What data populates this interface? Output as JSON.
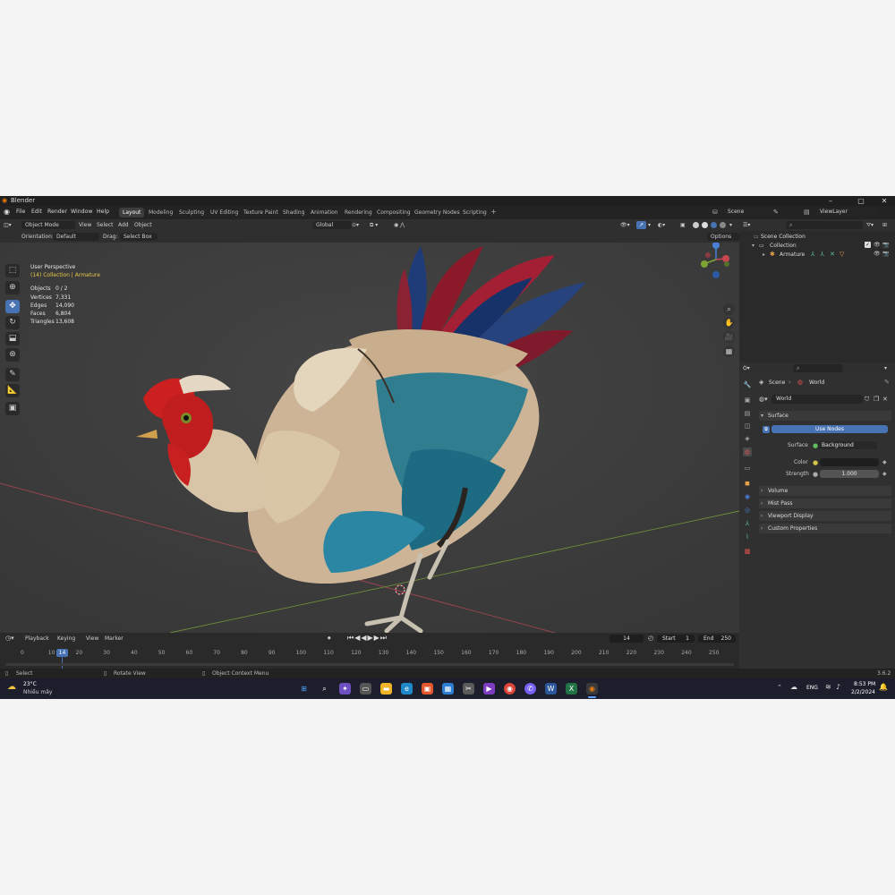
{
  "window": {
    "title": "Blender"
  },
  "menu": [
    "File",
    "Edit",
    "Render",
    "Window",
    "Help"
  ],
  "workspaces": [
    "Layout",
    "Modeling",
    "Sculpting",
    "UV Editing",
    "Texture Paint",
    "Shading",
    "Animation",
    "Rendering",
    "Compositing",
    "Geometry Nodes",
    "Scripting"
  ],
  "scene_field": "Scene",
  "viewlayer_field": "ViewLayer",
  "viewport_header": {
    "mode": "Object Mode",
    "items": [
      "View",
      "Select",
      "Add",
      "Object"
    ],
    "transform": "Global",
    "options": "Options"
  },
  "tool_header": {
    "orientation_label": "Orientation:",
    "orientation_value": "Default",
    "drag_label": "Drag:",
    "drag_value": "Select Box"
  },
  "overlay": {
    "view_name": "User Perspective",
    "collection_path": "(14) Collection | Armature"
  },
  "stats": [
    {
      "label": "Objects",
      "value": "0 / 2"
    },
    {
      "label": "Vertices",
      "value": "7,331"
    },
    {
      "label": "Edges",
      "value": "14,090"
    },
    {
      "label": "Faces",
      "value": "6,804"
    },
    {
      "label": "Triangles",
      "value": "13,608"
    }
  ],
  "timeline": {
    "menus": [
      "Playback",
      "Keying",
      "View",
      "Marker"
    ],
    "current_frame": "14",
    "start_label": "Start",
    "start": "1",
    "end_label": "End",
    "end": "250",
    "ticks": [
      "0",
      "10",
      "20",
      "30",
      "40",
      "50",
      "60",
      "70",
      "80",
      "90",
      "100",
      "110",
      "120",
      "130",
      "140",
      "150",
      "160",
      "170",
      "180",
      "190",
      "200",
      "210",
      "220",
      "230",
      "240",
      "250"
    ]
  },
  "statusbar": {
    "select": "Select",
    "rotate": "Rotate View",
    "context": "Object Context Menu",
    "version": "3.6.2"
  },
  "outliner": {
    "rows": [
      {
        "label": "Scene Collection"
      },
      {
        "label": "Collection"
      },
      {
        "label": "Armature"
      }
    ]
  },
  "properties": {
    "breadcrumb_scene": "Scene",
    "breadcrumb_world": "World",
    "world_name": "World",
    "surface_panel": "Surface",
    "use_nodes": "Use Nodes",
    "surface_label": "Surface",
    "surface_value": "Background",
    "color_label": "Color",
    "strength_label": "Strength",
    "strength_value": "1.000",
    "collapsed_panels": [
      "Volume",
      "Mist Pass",
      "Viewport Display",
      "Custom Properties"
    ]
  },
  "taskbar": {
    "weather_temp": "23°C",
    "weather_desc": "Nhiều mây",
    "language": "ENG",
    "time": "8:53 PM",
    "date": "2/2/2024"
  },
  "colors": {
    "accent": "#4772b3",
    "x_axis": "#c8474f",
    "y_axis": "#7ea533",
    "z_axis": "#4a7fd8"
  }
}
